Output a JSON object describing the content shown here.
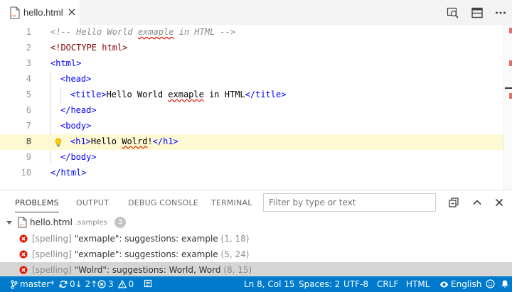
{
  "tab": {
    "filename": "hello.html"
  },
  "editor": {
    "lines": [
      {
        "num": "1",
        "text": "<!-- Hello World exmaple in HTML -->"
      },
      {
        "num": "2",
        "text": "<!DOCTYPE html>"
      },
      {
        "num": "3",
        "text": "<html>"
      },
      {
        "num": "4",
        "text": "<head>"
      },
      {
        "num": "5",
        "text": "<title>Hello World exmaple in HTML</title>"
      },
      {
        "num": "6",
        "text": "</head>"
      },
      {
        "num": "7",
        "text": "<body>"
      },
      {
        "num": "8",
        "text": "<h1>Hello Wolrd!</h1>"
      },
      {
        "num": "9",
        "text": "</body>"
      },
      {
        "num": "10",
        "text": "</html>"
      }
    ],
    "tokens": {
      "l1_a": "<!-- Hello World ",
      "l1_b": "exmaple",
      "l1_c": " in HTML -->",
      "l2": "<!DOCTYPE html>",
      "l3": "<html>",
      "l4": "<head>",
      "l5_open": "<title>",
      "l5_a": "Hello World ",
      "l5_b": "exmaple",
      "l5_c": " in HTML",
      "l5_close": "</title>",
      "l6": "</head>",
      "l7": "<body>",
      "l8_open": "<h1>",
      "l8_a": "Hello ",
      "l8_b": "Wolrd",
      "l8_c": "!",
      "l8_close": "</h1>",
      "l9": "</body>",
      "l10": "</html>"
    },
    "current_line": 8
  },
  "panel": {
    "tabs": [
      "PROBLEMS",
      "OUTPUT",
      "DEBUG CONSOLE",
      "TERMINAL"
    ],
    "active_tab": "PROBLEMS",
    "filter_placeholder": "Filter by type or text",
    "group": {
      "file": "hello.html",
      "folder": ".samples",
      "count": "3"
    },
    "problems": [
      {
        "source": "[spelling]",
        "message": "\"exmaple\": suggestions: example",
        "position": "(1, 18)"
      },
      {
        "source": "[spelling]",
        "message": "\"exmaple\": suggestions: example",
        "position": "(5, 24)"
      },
      {
        "source": "[spelling]",
        "message": "\"Wolrd\": suggestions: World, Word",
        "position": "(8, 15)"
      }
    ]
  },
  "status": {
    "branch": "master*",
    "sync": "0↓ 2↑",
    "errors": "3",
    "warnings": "0",
    "cursor": "Ln 8, Col 15",
    "spaces": "Spaces: 2",
    "encoding": "UTF-8",
    "eol": "CRLF",
    "language": "HTML",
    "spell_language": "English"
  },
  "colors": {
    "status_bar": "#007acc",
    "current_line": "#fdfad3",
    "error": "#e51400",
    "tag_bracket": "#800000",
    "tag_name": "#0000ff"
  }
}
